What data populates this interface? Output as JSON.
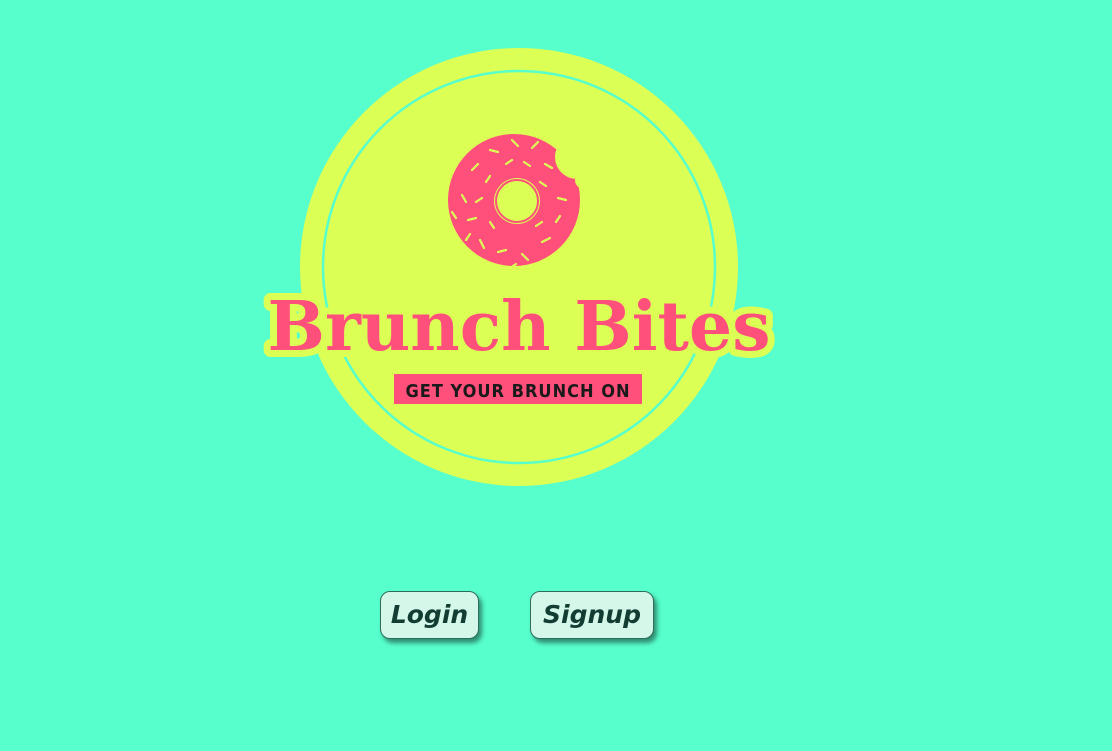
{
  "logo": {
    "title": "Brunch Bites",
    "tagline": "GET YOUR BRUNCH ON",
    "icon": "donut-icon"
  },
  "actions": {
    "login_label": "Login",
    "signup_label": "Signup"
  },
  "colors": {
    "background": "#57ffcd",
    "badge": "#dcff55",
    "accent": "#ff4f7b",
    "button_bg": "#d4f7ea",
    "button_text": "#133d33"
  }
}
